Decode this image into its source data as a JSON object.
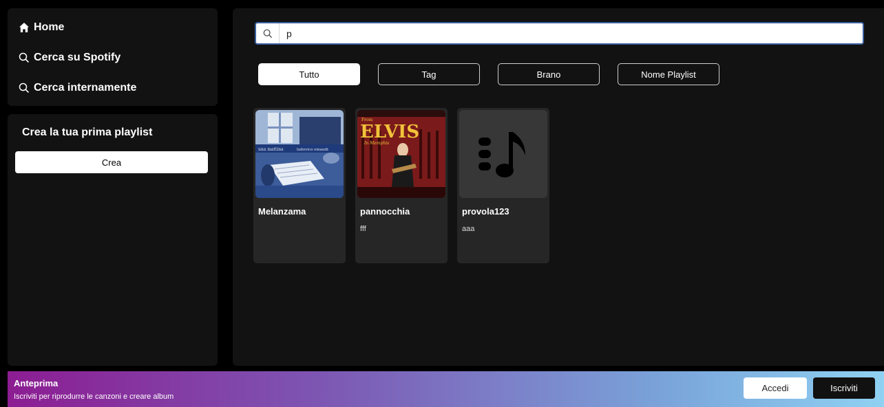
{
  "sidebar": {
    "nav": [
      {
        "label": "Home",
        "icon": "home-icon"
      },
      {
        "label": "Cerca su Spotify",
        "icon": "search-icon"
      },
      {
        "label": "Cerca internamente",
        "icon": "search-icon"
      }
    ],
    "library": {
      "title": "Crea la tua prima playlist",
      "create_label": "Crea"
    }
  },
  "search": {
    "value": "p",
    "icon": "search-icon"
  },
  "filters": [
    {
      "label": "Tutto",
      "active": true
    },
    {
      "label": "Tag",
      "active": false
    },
    {
      "label": "Brano",
      "active": false
    },
    {
      "label": "Nome Playlist",
      "active": false
    }
  ],
  "playlists": [
    {
      "title": "Melanzama",
      "subtitle": "",
      "cover": "album-art-blue",
      "cover_text": [
        "una mattina",
        "ludovico einaudi"
      ]
    },
    {
      "title": "pannocchia",
      "subtitle": "fff",
      "cover": "album-art-elvis",
      "cover_text": [
        "From",
        "ELVIS",
        "In Memphis"
      ]
    },
    {
      "title": "provola123",
      "subtitle": "aaa",
      "cover": "music-note-icon",
      "cover_text": []
    }
  ],
  "banner": {
    "title": "Anteprima",
    "subtitle": "Iscriviti per riprodurre le canzoni e creare album",
    "login_label": "Accedi",
    "signup_label": "Iscriviti"
  },
  "colors": {
    "background": "#000000",
    "panel": "#121212",
    "card": "#262626",
    "banner_start": "#8c1d92",
    "banner_end": "#8fd1f2",
    "search_border": "#3a5fa0"
  }
}
